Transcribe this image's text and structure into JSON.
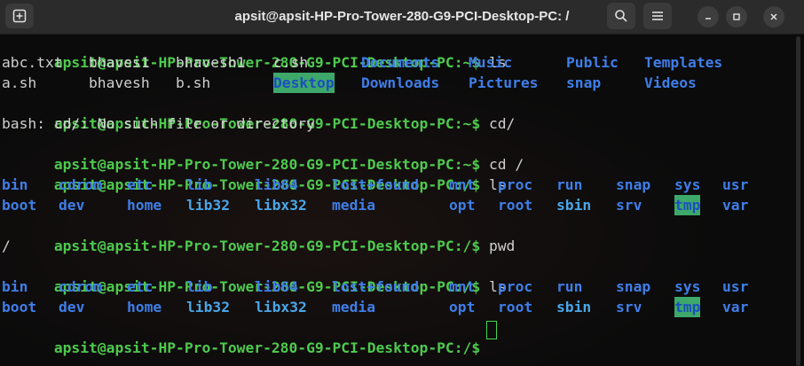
{
  "window": {
    "title": "apsit@apsit-HP-Pro-Tower-280-G9-PCI-Desktop-PC: /",
    "icons": {
      "new_tab": "new-tab-icon",
      "search": "search-icon",
      "menu": "hamburger-menu-icon",
      "minimize": "minimize-icon",
      "maximize": "maximize-icon",
      "close": "close-icon"
    }
  },
  "terminal": {
    "prompt_home": "apsit@apsit-HP-Pro-Tower-280-G9-PCI-Desktop-PC:~$",
    "prompt_root": "apsit@apsit-HP-Pro-Tower-280-G9-PCI-Desktop-PC:/$",
    "commands": [
      "ls",
      "cd/",
      "cd /",
      "ls",
      "pwd",
      "ls"
    ],
    "ls_home": {
      "row1": [
        "abc.txt",
        "bhaves1",
        "bhavesh1",
        "c.sh",
        "Documents",
        "Music",
        "Public",
        "Templates"
      ],
      "row2": [
        "a.sh",
        "bhavesh",
        "b.sh",
        "Desktop",
        "Downloads",
        "Pictures",
        "snap",
        "Videos"
      ]
    },
    "error": "bash: cd/: No such file or directory",
    "ls_root": {
      "row1": [
        "bin",
        "cdrom",
        "etc",
        "lib",
        "lib64",
        "lost+found",
        "mnt",
        "proc",
        "run",
        "snap",
        "sys",
        "usr"
      ],
      "row2": [
        "boot",
        "dev",
        "home",
        "lib32",
        "libx32",
        "media",
        "opt",
        "root",
        "sbin",
        "srv",
        "tmp",
        "var"
      ]
    },
    "pwd_output": "/"
  },
  "colors": {
    "prompt": "#4ec94e",
    "directory": "#3f7ee8",
    "highlight_bg": "#3da86a",
    "background": "#0b0b0b"
  }
}
